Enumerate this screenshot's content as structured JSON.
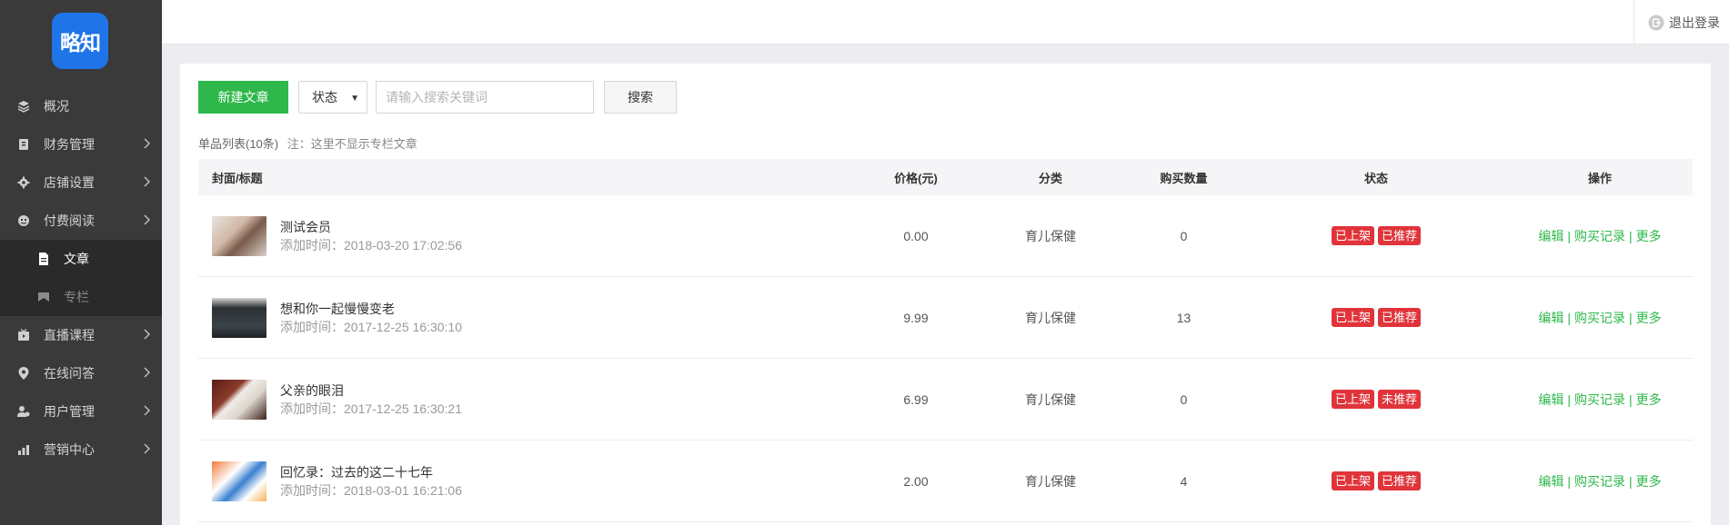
{
  "brand": {
    "logo_text": "略知",
    "accent": "#1f74e8"
  },
  "sidebar": {
    "items": [
      {
        "label": "概况",
        "icon": "layers-icon",
        "has_children": false
      },
      {
        "label": "财务管理",
        "icon": "book-icon",
        "has_children": true
      },
      {
        "label": "店铺设置",
        "icon": "gear-icon",
        "has_children": true
      },
      {
        "label": "付费阅读",
        "icon": "reader-icon",
        "has_children": true
      },
      {
        "label": "直播课程",
        "icon": "video-icon",
        "has_children": true
      },
      {
        "label": "在线问答",
        "icon": "pin-icon",
        "has_children": true
      },
      {
        "label": "用户管理",
        "icon": "users-icon",
        "has_children": true
      },
      {
        "label": "营销中心",
        "icon": "chart-icon",
        "has_children": true
      }
    ],
    "sub_items": [
      {
        "label": "文章",
        "icon": "document-icon",
        "active": true
      },
      {
        "label": "专栏",
        "icon": "bookmark-icon",
        "active": false
      }
    ]
  },
  "topbar": {
    "logout_label": "退出登录"
  },
  "toolbar": {
    "new_button": "新建文章",
    "status_select": "状态",
    "search_placeholder": "请输入搜索关键词",
    "search_button": "搜索"
  },
  "list": {
    "count_label": "单品列表(10条)",
    "note": "注：这里不显示专栏文章"
  },
  "table": {
    "headers": {
      "title": "封面/标题",
      "price": "价格(元)",
      "category": "分类",
      "purchases": "购买数量",
      "status": "状态",
      "actions": "操作"
    },
    "rows": [
      {
        "title": "测试会员",
        "added": "添加时间：2018-03-20 17:02:56",
        "price": "0.00",
        "category": "育儿保健",
        "purchases": "0",
        "status1": "已上架",
        "status2": "已推荐",
        "edit": "编辑",
        "records": "购买记录",
        "more": "更多"
      },
      {
        "title": "想和你一起慢慢变老",
        "added": "添加时间：2017-12-25 16:30:10",
        "price": "9.99",
        "category": "育儿保健",
        "purchases": "13",
        "status1": "已上架",
        "status2": "已推荐",
        "edit": "编辑",
        "records": "购买记录",
        "more": "更多"
      },
      {
        "title": "父亲的眼泪",
        "added": "添加时间：2017-12-25 16:30:21",
        "price": "6.99",
        "category": "育儿保健",
        "purchases": "0",
        "status1": "已上架",
        "status2": "未推荐",
        "edit": "编辑",
        "records": "购买记录",
        "more": "更多"
      },
      {
        "title": "回忆录：过去的这二十七年",
        "added": "添加时间：2018-03-01 16:21:06",
        "price": "2.00",
        "category": "育儿保健",
        "purchases": "4",
        "status1": "已上架",
        "status2": "已推荐",
        "edit": "编辑",
        "records": "购买记录",
        "more": "更多"
      }
    ]
  },
  "colors": {
    "primary_green": "#2eb84b",
    "tag_red": "#e0343a",
    "sidebar_bg": "#3a3a3a"
  }
}
